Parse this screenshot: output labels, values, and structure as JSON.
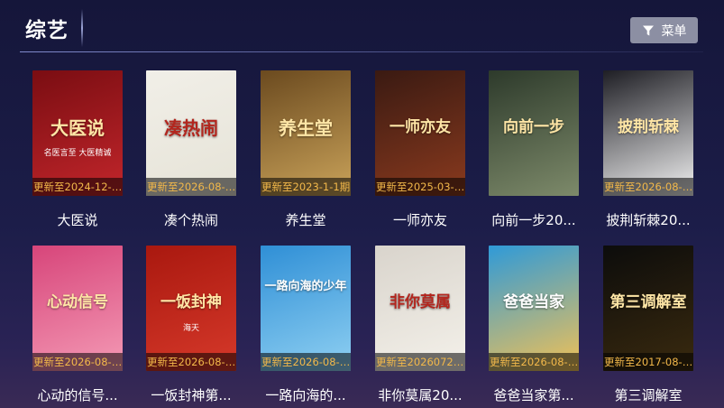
{
  "header": {
    "title": "综艺",
    "menu_label": "菜单",
    "menu_icon": "filter-icon"
  },
  "cards": [
    {
      "title": "大医说",
      "update": "更新至2024-12-2...",
      "poster_text": "大医说",
      "poster_sub": "名医言至 大医精诚",
      "colors": [
        "#7a0d12",
        "#c2262b"
      ]
    },
    {
      "title": "凑个热闹",
      "update": "更新至2026-08-0...",
      "poster_text": "凑热闹",
      "poster_sub": "",
      "colors": [
        "#f1efe8",
        "#e6e3d7"
      ]
    },
    {
      "title": "养生堂",
      "update": "更新至2023-1-1期",
      "poster_text": "养生堂",
      "poster_sub": "",
      "colors": [
        "#6b4a1f",
        "#caa35a"
      ]
    },
    {
      "title": "一师亦友",
      "update": "更新至2025-03-1...",
      "poster_text": "一师亦友",
      "poster_sub": "",
      "colors": [
        "#3a1a12",
        "#8a3a1e"
      ]
    },
    {
      "title": "向前一步20...",
      "update": "",
      "poster_text": "向前一步",
      "poster_sub": "",
      "colors": [
        "#2d3a2b",
        "#7d8a6a"
      ]
    },
    {
      "title": "披荆斩棘20...",
      "update": "更新至2026-08-0...",
      "poster_text": "披荆斩棘",
      "poster_sub": "",
      "colors": [
        "#1e1e24",
        "#f3f3f3"
      ]
    },
    {
      "title": "心动的信号...",
      "update": "更新至2026-08-1...",
      "poster_text": "心动信号",
      "poster_sub": "",
      "colors": [
        "#d7457a",
        "#f49ab5"
      ]
    },
    {
      "title": "一饭封神第...",
      "update": "更新至2026-08-0...",
      "poster_text": "一饭封神",
      "poster_sub": "海天",
      "colors": [
        "#a9180f",
        "#d6392a"
      ]
    },
    {
      "title": "一路向海的...",
      "update": "更新至2026-08-0...",
      "poster_text": "一路向海的少年",
      "poster_sub": "",
      "colors": [
        "#2f8fd6",
        "#8fd0f2"
      ]
    },
    {
      "title": "非你莫属20...",
      "update": "更新至20260726...",
      "poster_text": "非你莫属",
      "poster_sub": "",
      "colors": [
        "#d9d4cc",
        "#f4f1ea"
      ]
    },
    {
      "title": "爸爸当家第...",
      "update": "更新至2026-08-0...",
      "poster_text": "爸爸当家",
      "poster_sub": "",
      "colors": [
        "#2f9ad8",
        "#f2c155"
      ]
    },
    {
      "title": "第三调解室",
      "update": "更新至2017-08-0...",
      "poster_text": "第三调解室",
      "poster_sub": "",
      "colors": [
        "#0c0c0c",
        "#3a2a0e"
      ]
    }
  ]
}
